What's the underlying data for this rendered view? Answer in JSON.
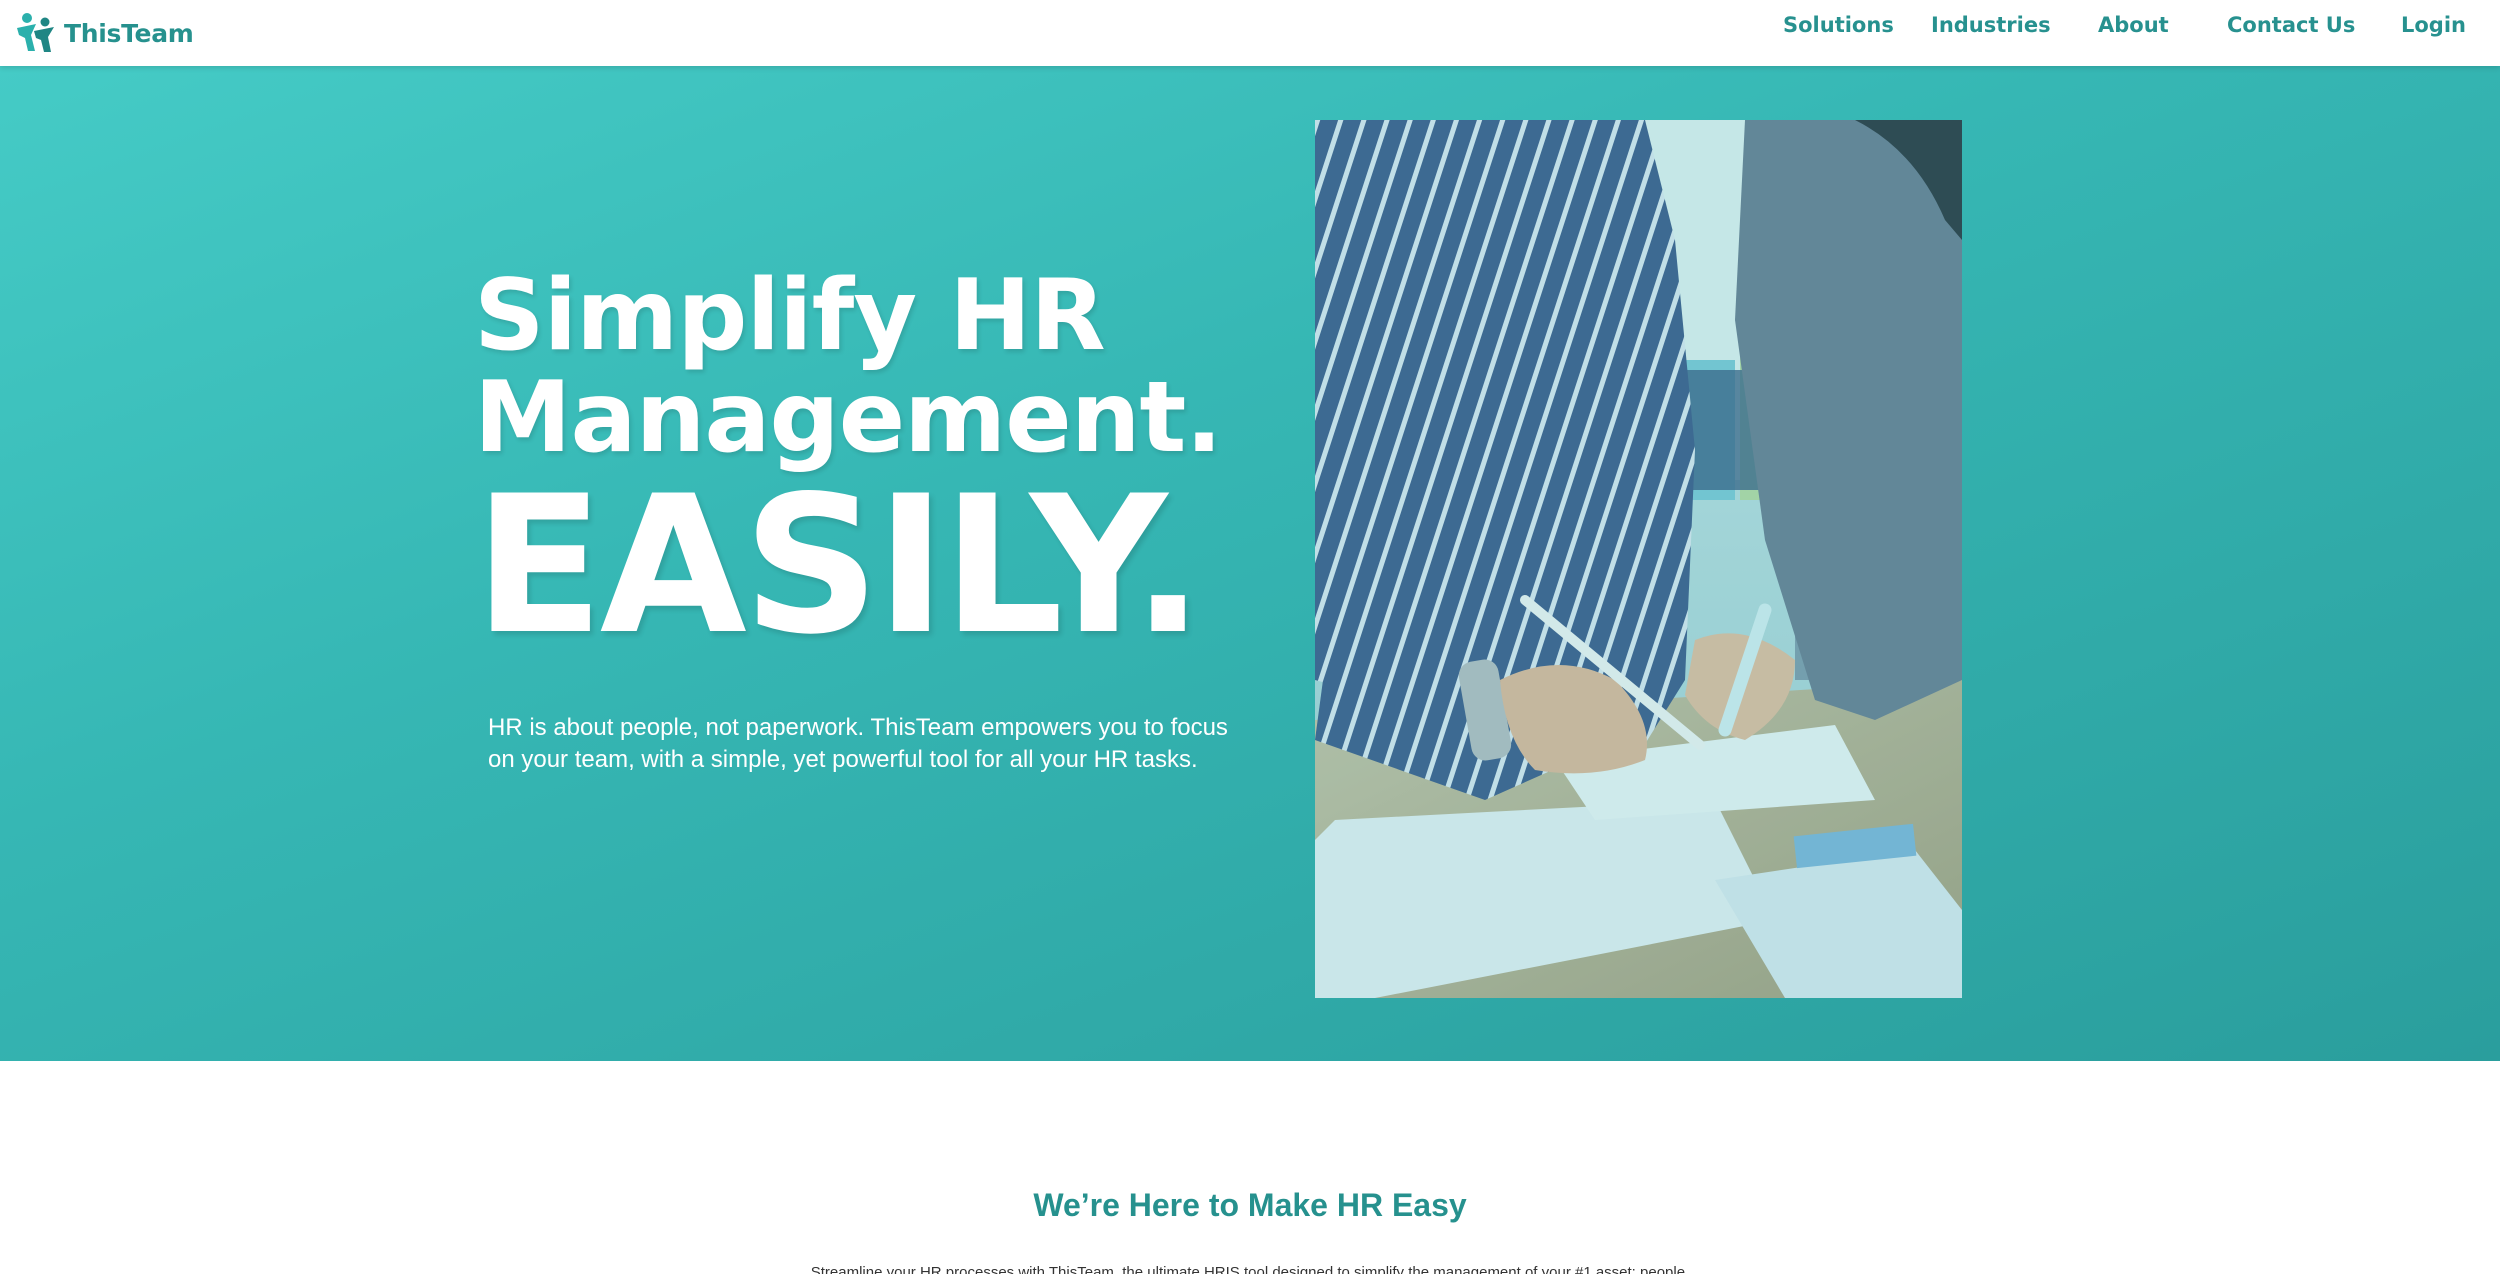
{
  "brand": {
    "name": "ThisTeam",
    "logo_icon": "people-icon",
    "color": "#26918e"
  },
  "nav": {
    "items": [
      {
        "label": "Solutions"
      },
      {
        "label": "Industries"
      },
      {
        "label": "About"
      },
      {
        "label": "Contact Us"
      },
      {
        "label": "Login"
      }
    ]
  },
  "hero": {
    "title_line_1": "Simplify HR",
    "title_line_2": "Management.",
    "emphasis": "EASILY.",
    "description": "HR is about people, not paperwork. ThisTeam empowers you to focus on your team, with a simple, yet powerful tool for all your HR tasks.",
    "image_subject": "office-collaboration-photo",
    "background_colors": [
      "#45cbc6",
      "#2a9e9d"
    ]
  },
  "section": {
    "title": "We’re Here to Make HR Easy",
    "text": "Streamline your HR processes with ThisTeam, the ultimate HRIS tool designed to simplify the management of your #1 asset: people."
  }
}
